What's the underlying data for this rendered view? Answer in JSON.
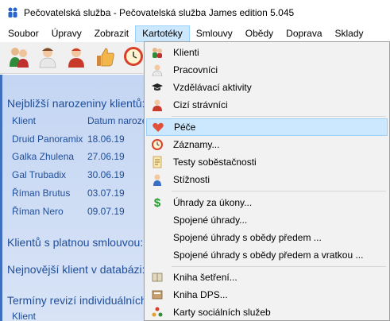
{
  "window": {
    "title": "Pečovatelská služba - Pečovatelská služba James edition 5.045"
  },
  "menubar": {
    "items": [
      {
        "label": "Soubor"
      },
      {
        "label": "Úpravy"
      },
      {
        "label": "Zobrazit"
      },
      {
        "label": "Kartotéky",
        "open": true
      },
      {
        "label": "Smlouvy"
      },
      {
        "label": "Obědy"
      },
      {
        "label": "Doprava"
      },
      {
        "label": "Sklady"
      }
    ]
  },
  "toolbar": {
    "buttons": [
      {
        "icon": "clients-group-icon"
      },
      {
        "icon": "nurse-icon"
      },
      {
        "icon": "worker-icon"
      },
      {
        "icon": "thumbs-up-icon"
      },
      {
        "icon": "clock-icon"
      }
    ]
  },
  "main": {
    "birthdays_title": "Nejbližší narozeniny klientů:",
    "col_client": "Klient",
    "col_date": "Datum naroze",
    "birthdays": [
      {
        "name": "Druid Panoramix",
        "date": "18.06.19"
      },
      {
        "name": "Galka Zhulena",
        "date": "27.06.19"
      },
      {
        "name": "Gal Trubadix",
        "date": "30.06.19"
      },
      {
        "name": "Říman Brutus",
        "date": "03.07.19"
      },
      {
        "name": "Říman Nero",
        "date": "09.07.19"
      }
    ],
    "contract_title": "Klientů s platnou smlouvou:",
    "newest_title": "Nejnovější klient v databázi:",
    "revisions_title": "Termíny revizí individuálních p",
    "revisions_col_client": "Klient"
  },
  "dropdown": {
    "items": [
      {
        "label": "Klienti",
        "icon": "clients-icon"
      },
      {
        "label": "Pracovníci",
        "icon": "worker-icon"
      },
      {
        "label": "Vzdělávací aktivity",
        "icon": "graduation-cap-icon"
      },
      {
        "label": "Cizí strávníci",
        "icon": "diner-icon"
      },
      {
        "label": "Péče",
        "icon": "heart-icon",
        "highlighted": true
      },
      {
        "label": "Záznamy...",
        "icon": "clock-icon"
      },
      {
        "label": "Testy soběstačnosti",
        "icon": "checklist-icon"
      },
      {
        "label": "Stížnosti",
        "icon": "person-icon"
      },
      {
        "label": "Úhrady za úkony...",
        "icon": "dollar-icon"
      },
      {
        "label": "Spojené úhrady..."
      },
      {
        "label": "Spojené úhrady s obědy předem ..."
      },
      {
        "label": "Spojené úhrady s obědy předem a vratkou ..."
      },
      {
        "label": "Kniha šetření...",
        "icon": "book-icon"
      },
      {
        "label": "Kniha DPS...",
        "icon": "book-dps-icon"
      },
      {
        "label": "Karty sociálních služeb",
        "icon": "cards-icon"
      }
    ]
  },
  "colors": {
    "accent_text": "#1f4e9a",
    "menu_highlight": "#cce8ff",
    "menu_highlight_border": "#99d1ff"
  }
}
